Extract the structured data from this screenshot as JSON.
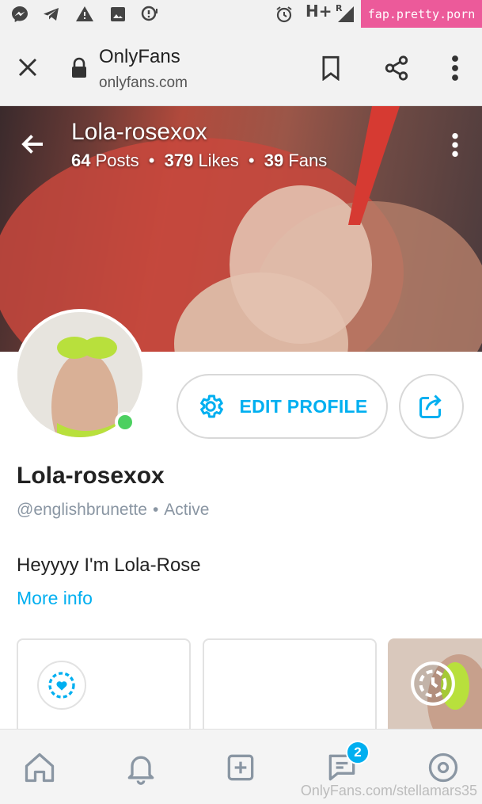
{
  "status_bar": {
    "network_text": "H+",
    "signal_sub": "R",
    "watermark": "fap.pretty.porn"
  },
  "browser": {
    "title": "OnlyFans",
    "url": "onlyfans.com"
  },
  "cover": {
    "name": "Lola-rosexox",
    "posts_count": "64",
    "posts_label": "Posts",
    "likes_count": "379",
    "likes_label": "Likes",
    "fans_count": "39",
    "fans_label": "Fans"
  },
  "profile": {
    "edit_label": "EDIT PROFILE",
    "display_name": "Lola-rosexox",
    "handle": "@englishbrunette",
    "status": "Active",
    "bio": "Heyyyy I'm Lola-Rose",
    "more_info": "More info"
  },
  "nav": {
    "messages_badge": "2"
  },
  "footer": {
    "watermark": "OnlyFans.com/stellamars35"
  },
  "colors": {
    "accent": "#00aff0",
    "online": "#4cd060",
    "watermark_bg": "#ec5a9a"
  }
}
